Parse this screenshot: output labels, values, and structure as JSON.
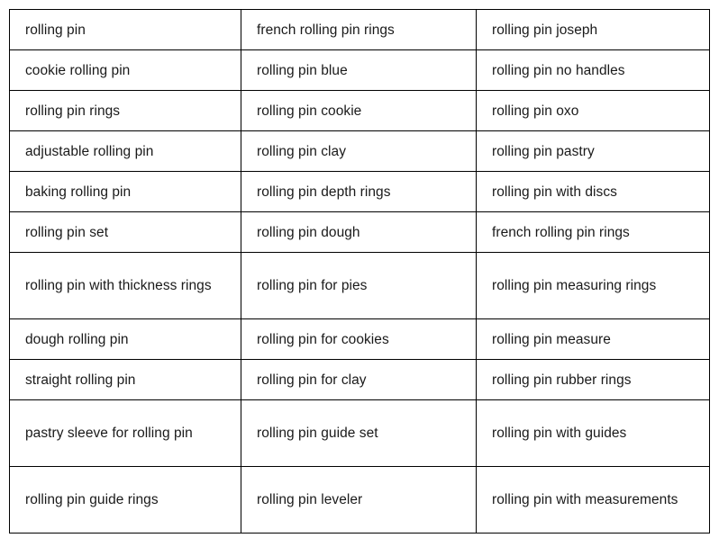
{
  "table": {
    "columns": 3,
    "rows": [
      {
        "height": "normal",
        "cells": [
          "rolling pin",
          "french rolling pin rings",
          "rolling pin joseph"
        ]
      },
      {
        "height": "normal",
        "cells": [
          "cookie rolling pin",
          "rolling pin blue",
          "rolling pin no handles"
        ]
      },
      {
        "height": "normal",
        "cells": [
          "rolling pin rings",
          "rolling pin cookie",
          "rolling pin oxo"
        ]
      },
      {
        "height": "normal",
        "cells": [
          "adjustable rolling pin",
          "rolling pin clay",
          "rolling pin pastry"
        ]
      },
      {
        "height": "normal",
        "cells": [
          "baking rolling pin",
          "rolling pin depth rings",
          "rolling pin with discs"
        ]
      },
      {
        "height": "normal",
        "cells": [
          "rolling pin set",
          "rolling pin dough",
          "french rolling pin rings"
        ]
      },
      {
        "height": "tall",
        "cells": [
          "rolling pin with thickness rings",
          "rolling pin for pies",
          "rolling pin measuring rings"
        ]
      },
      {
        "height": "normal",
        "cells": [
          "dough rolling pin",
          "rolling pin for cookies",
          "rolling pin measure"
        ]
      },
      {
        "height": "normal",
        "cells": [
          "straight rolling pin",
          "rolling pin for clay",
          "rolling pin rubber rings"
        ]
      },
      {
        "height": "tall",
        "cells": [
          "pastry sleeve for rolling pin",
          "rolling pin guide set",
          "rolling pin with guides"
        ]
      },
      {
        "height": "tall",
        "cells": [
          "rolling pin guide rings",
          "rolling pin leveler",
          "rolling pin with measurements"
        ]
      }
    ]
  },
  "style": {
    "border_color": "#000000",
    "text_color": "#1a1a1a",
    "background_color": "#ffffff"
  }
}
